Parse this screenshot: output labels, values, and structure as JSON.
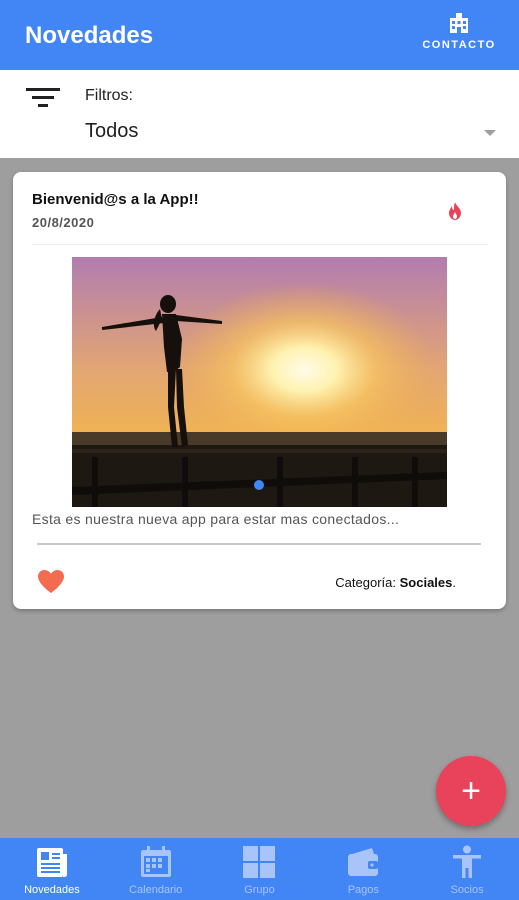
{
  "colors": {
    "primary": "#4285f4",
    "accent": "#e9435b",
    "background": "#9e9e9e",
    "inactive_nav": "#a9c4f8"
  },
  "header": {
    "title": "Novedades",
    "contact": {
      "label": "CONTACTO",
      "icon": "building-icon"
    }
  },
  "filters": {
    "icon": "filter-icon",
    "label": "Filtros:",
    "selected": "Todos"
  },
  "posts": [
    {
      "title": "Bienvenid@s a la App!!",
      "date": "20/8/2020",
      "badge_icon": "fire-icon",
      "image": "sunset-silhouette",
      "text": "Esta es nuestra nueva app para estar mas conectados...",
      "like_icon": "heart-icon",
      "category_label": "Categoría:",
      "category_value": "Sociales",
      "category_suffix": "."
    }
  ],
  "fab": {
    "label": "+"
  },
  "bottom_nav": [
    {
      "label": "Novedades",
      "icon": "newspaper-icon",
      "active": true
    },
    {
      "label": "Calendario",
      "icon": "calendar-icon",
      "active": false
    },
    {
      "label": "Grupo",
      "icon": "grid-icon",
      "active": false
    },
    {
      "label": "Pagos",
      "icon": "wallet-icon",
      "active": false
    },
    {
      "label": "Socios",
      "icon": "person-icon",
      "active": false
    }
  ]
}
